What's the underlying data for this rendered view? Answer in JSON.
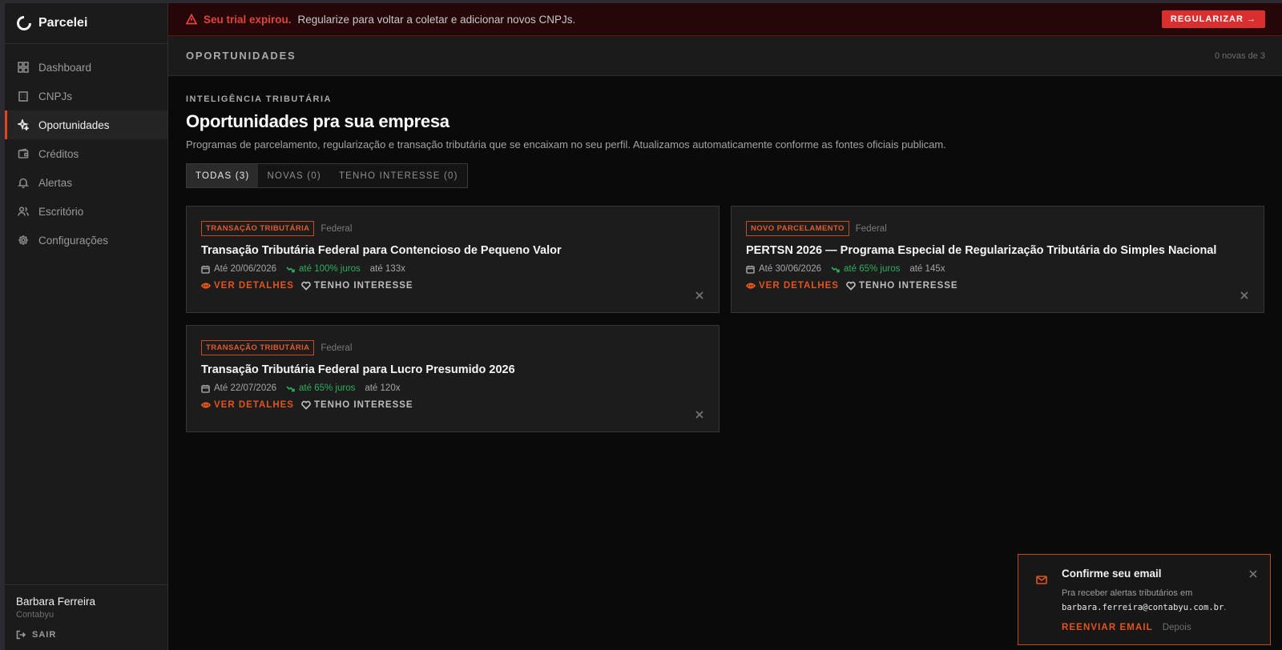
{
  "brand": {
    "name": "Parcelei"
  },
  "sidebar": {
    "items": [
      {
        "label": "Dashboard",
        "icon": "dashboard-icon",
        "active": false
      },
      {
        "label": "CNPJs",
        "icon": "building-icon",
        "active": false
      },
      {
        "label": "Oportunidades",
        "icon": "sparkles-icon",
        "active": true
      },
      {
        "label": "Créditos",
        "icon": "wallet-icon",
        "active": false
      },
      {
        "label": "Alertas",
        "icon": "bell-icon",
        "active": false
      },
      {
        "label": "Escritório",
        "icon": "users-icon",
        "active": false
      },
      {
        "label": "Configurações",
        "icon": "gear-icon",
        "active": false
      }
    ],
    "user": {
      "name": "Barbara Ferreira",
      "org": "Contabyu"
    },
    "logout_label": "SAIR"
  },
  "trial_banner": {
    "strong": "Seu trial expirou.",
    "text": "Regularize para voltar a coletar e adicionar novos CNPJs.",
    "button": "REGULARIZAR →"
  },
  "topbar": {
    "title": "OPORTUNIDADES",
    "count": "0 novas de 3"
  },
  "main": {
    "eyebrow": "INTELIGÊNCIA TRIBUTÁRIA",
    "heading": "Oportunidades pra sua empresa",
    "description": "Programas de parcelamento, regularização e transação tributária que se encaixam no seu perfil. Atualizamos automaticamente conforme as fontes oficiais publicam.",
    "tabs": [
      {
        "label": "TODAS (3)",
        "active": true
      },
      {
        "label": "NOVAS (0)",
        "active": false
      },
      {
        "label": "TENHO INTERESSE (0)",
        "active": false
      }
    ],
    "cards": [
      {
        "badge": "TRANSAÇÃO TRIBUTÁRIA",
        "scope": "Federal",
        "title": "Transação Tributária Federal para Contencioso de Pequeno Valor",
        "deadline": "Até 20/06/2026",
        "juros": "até 100% juros",
        "parcelas": "até 133x",
        "details_label": "VER DETALHES",
        "interest_label": "TENHO INTERESSE"
      },
      {
        "badge": "NOVO PARCELAMENTO",
        "scope": "Federal",
        "title": "PERTSN 2026 — Programa Especial de Regularização Tributária do Simples Nacional",
        "deadline": "Até 30/06/2026",
        "juros": "até 65% juros",
        "parcelas": "até 145x",
        "details_label": "VER DETALHES",
        "interest_label": "TENHO INTERESSE"
      },
      {
        "badge": "TRANSAÇÃO TRIBUTÁRIA",
        "scope": "Federal",
        "title": "Transação Tributária Federal para Lucro Presumido 2026",
        "deadline": "Até 22/07/2026",
        "juros": "até 65% juros",
        "parcelas": "até 120x",
        "details_label": "VER DETALHES",
        "interest_label": "TENHO INTERESSE"
      }
    ]
  },
  "toast": {
    "title": "Confirme seu email",
    "body_prefix": "Pra receber alertas tributários em ",
    "email": "barbara.ferreira@contabyu.com.br",
    "body_suffix": ".",
    "resend_label": "REENVIAR EMAIL",
    "later_label": "Depois"
  },
  "colors": {
    "accent": "#e2541f",
    "danger": "#d92f2f",
    "success": "#2fae5b",
    "background": "#0a0a0a"
  }
}
